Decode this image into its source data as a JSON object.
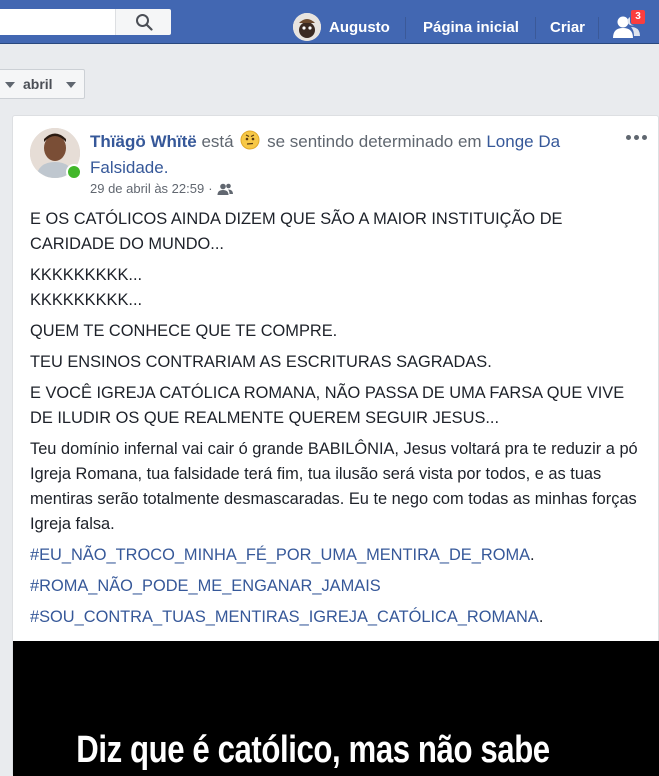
{
  "topbar": {
    "user_name": "Augusto",
    "home_label": "Página inicial",
    "create_label": "Criar",
    "friend_requests_count": "3",
    "search_icon": "search-icon",
    "brand_color": "#4267b2"
  },
  "filter": {
    "month_value": "abril"
  },
  "post": {
    "author": "Thïägö Whïtë",
    "esta": "está",
    "feeling_text": "se sentindo determinado em",
    "place_line1": "Longe Da",
    "place_line2": "Falsidade.",
    "timestamp": "29 de abril às 22:59",
    "separator": "·",
    "audience_icon": "friends-audience-icon",
    "paragraphs": {
      "p1": "E OS CATÓLICOS AINDA DIZEM QUE SÃO A MAIOR INSTITUIÇÃO DE CARIDADE DO MUNDO...",
      "p2a": "KKKKKKKKK...",
      "p2b": "KKKKKKKKK...",
      "p3": "QUEM TE CONHECE QUE TE COMPRE.",
      "p4": "TEU ENSINOS CONTRARIAM AS ESCRITURAS SAGRADAS.",
      "p5": "E VOCÊ IGREJA CATÓLICA ROMANA, NÃO PASSA DE UMA FARSA QUE VIVE DE ILUDIR OS QUE REALMENTE QUEREM SEGUIR JESUS...",
      "p6": "Teu domínio infernal vai cair ó grande BABILÔNIA, Jesus voltará pra te reduzir a pó Igreja Romana, tua falsidade terá fim, tua ilusão será vista por todos, e as tuas mentiras serão totalmente desmascaradas. Eu te nego com todas as minhas forças Igreja falsa."
    },
    "hashtags": {
      "h1": "#EU_NÃO_TROCO_MINHA_FÉ_POR_UMA_MENTIRA_DE_ROMA",
      "h1_end": ".",
      "h2": "#ROMA_NÃO_PODE_ME_ENGANAR_JAMAIS",
      "h3": "#SOU_CONTRA_TUAS_MENTIRAS_IGREJA_CATÓLICA_ROMANA",
      "h3_end": "."
    },
    "video_caption": "Diz que é católico, mas não sabe"
  }
}
